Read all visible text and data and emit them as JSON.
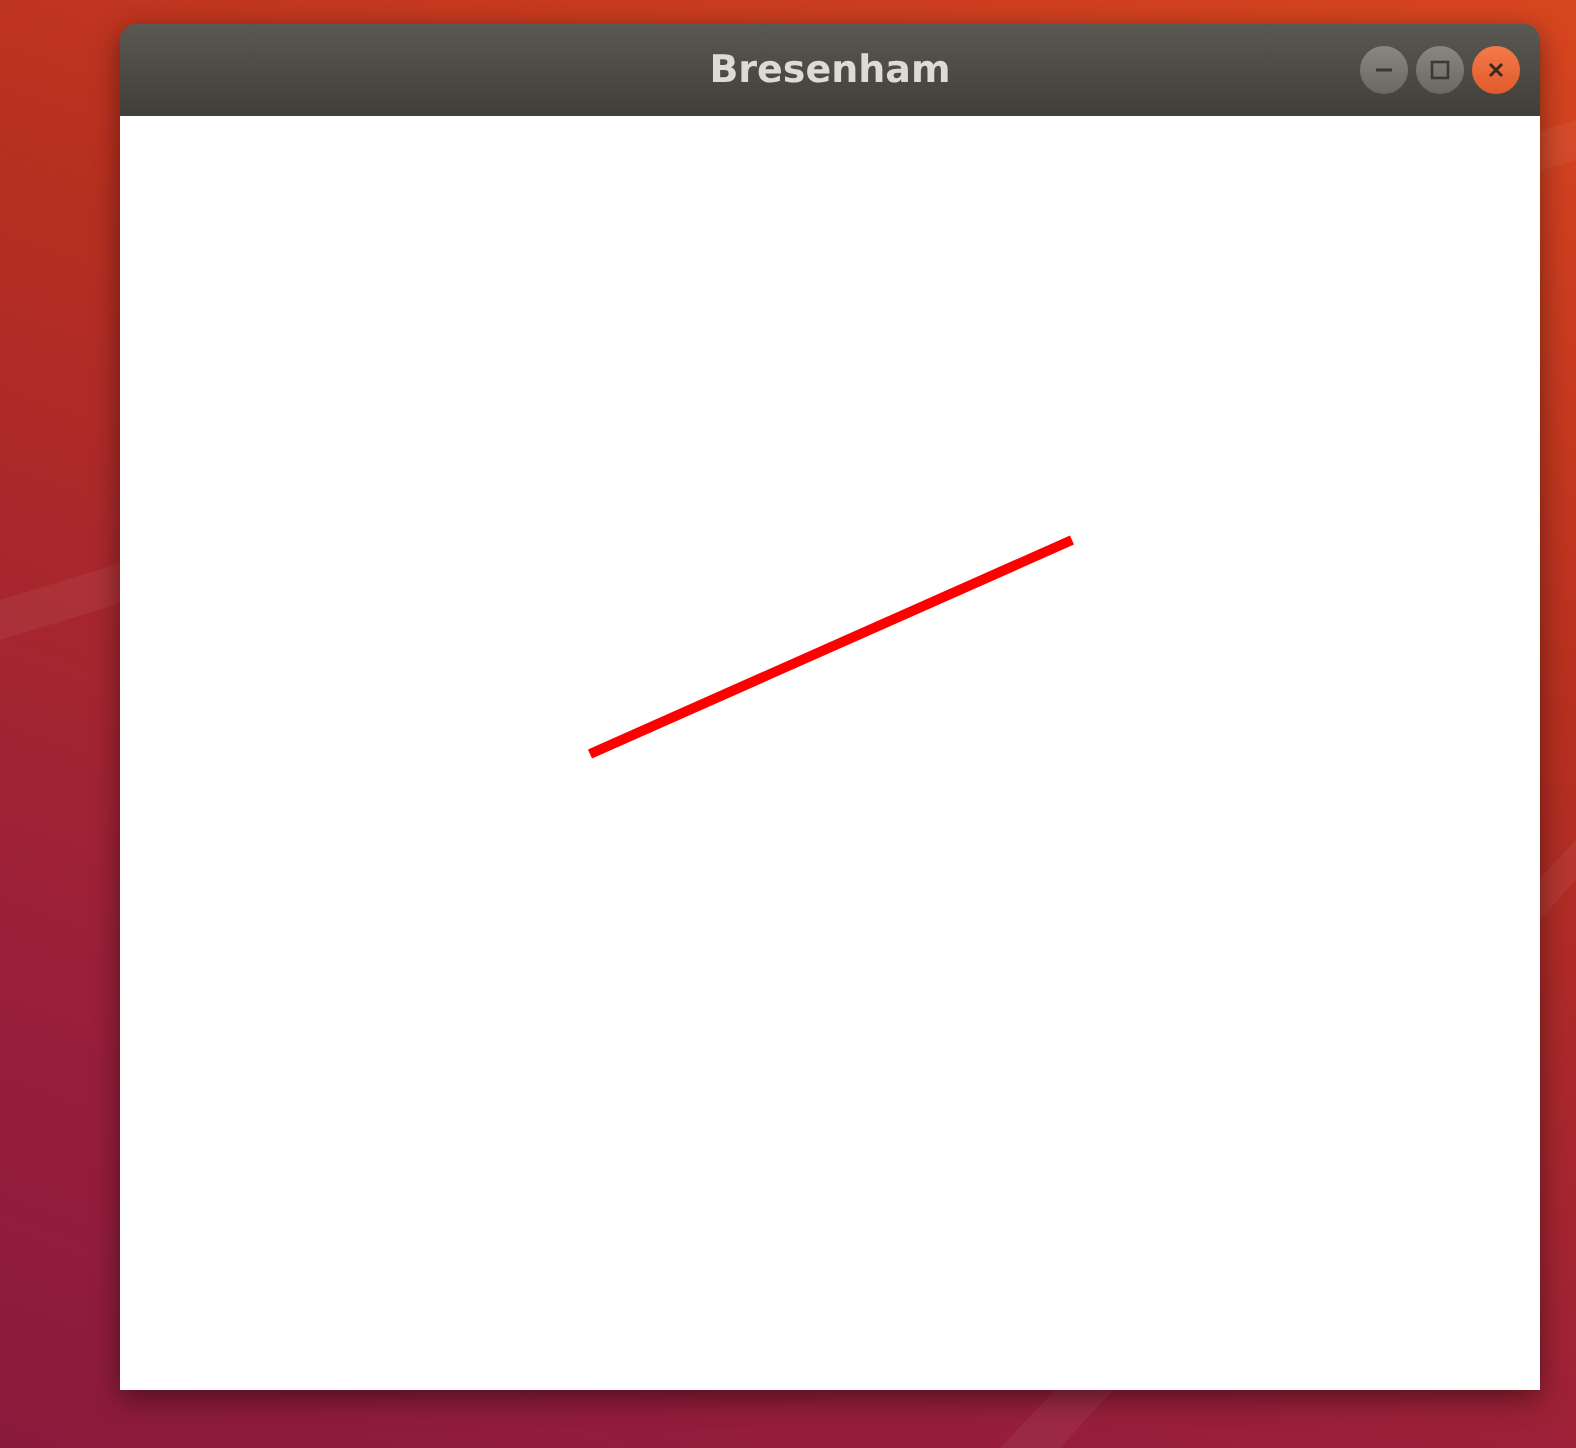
{
  "window": {
    "title": "Bresenham"
  }
}
